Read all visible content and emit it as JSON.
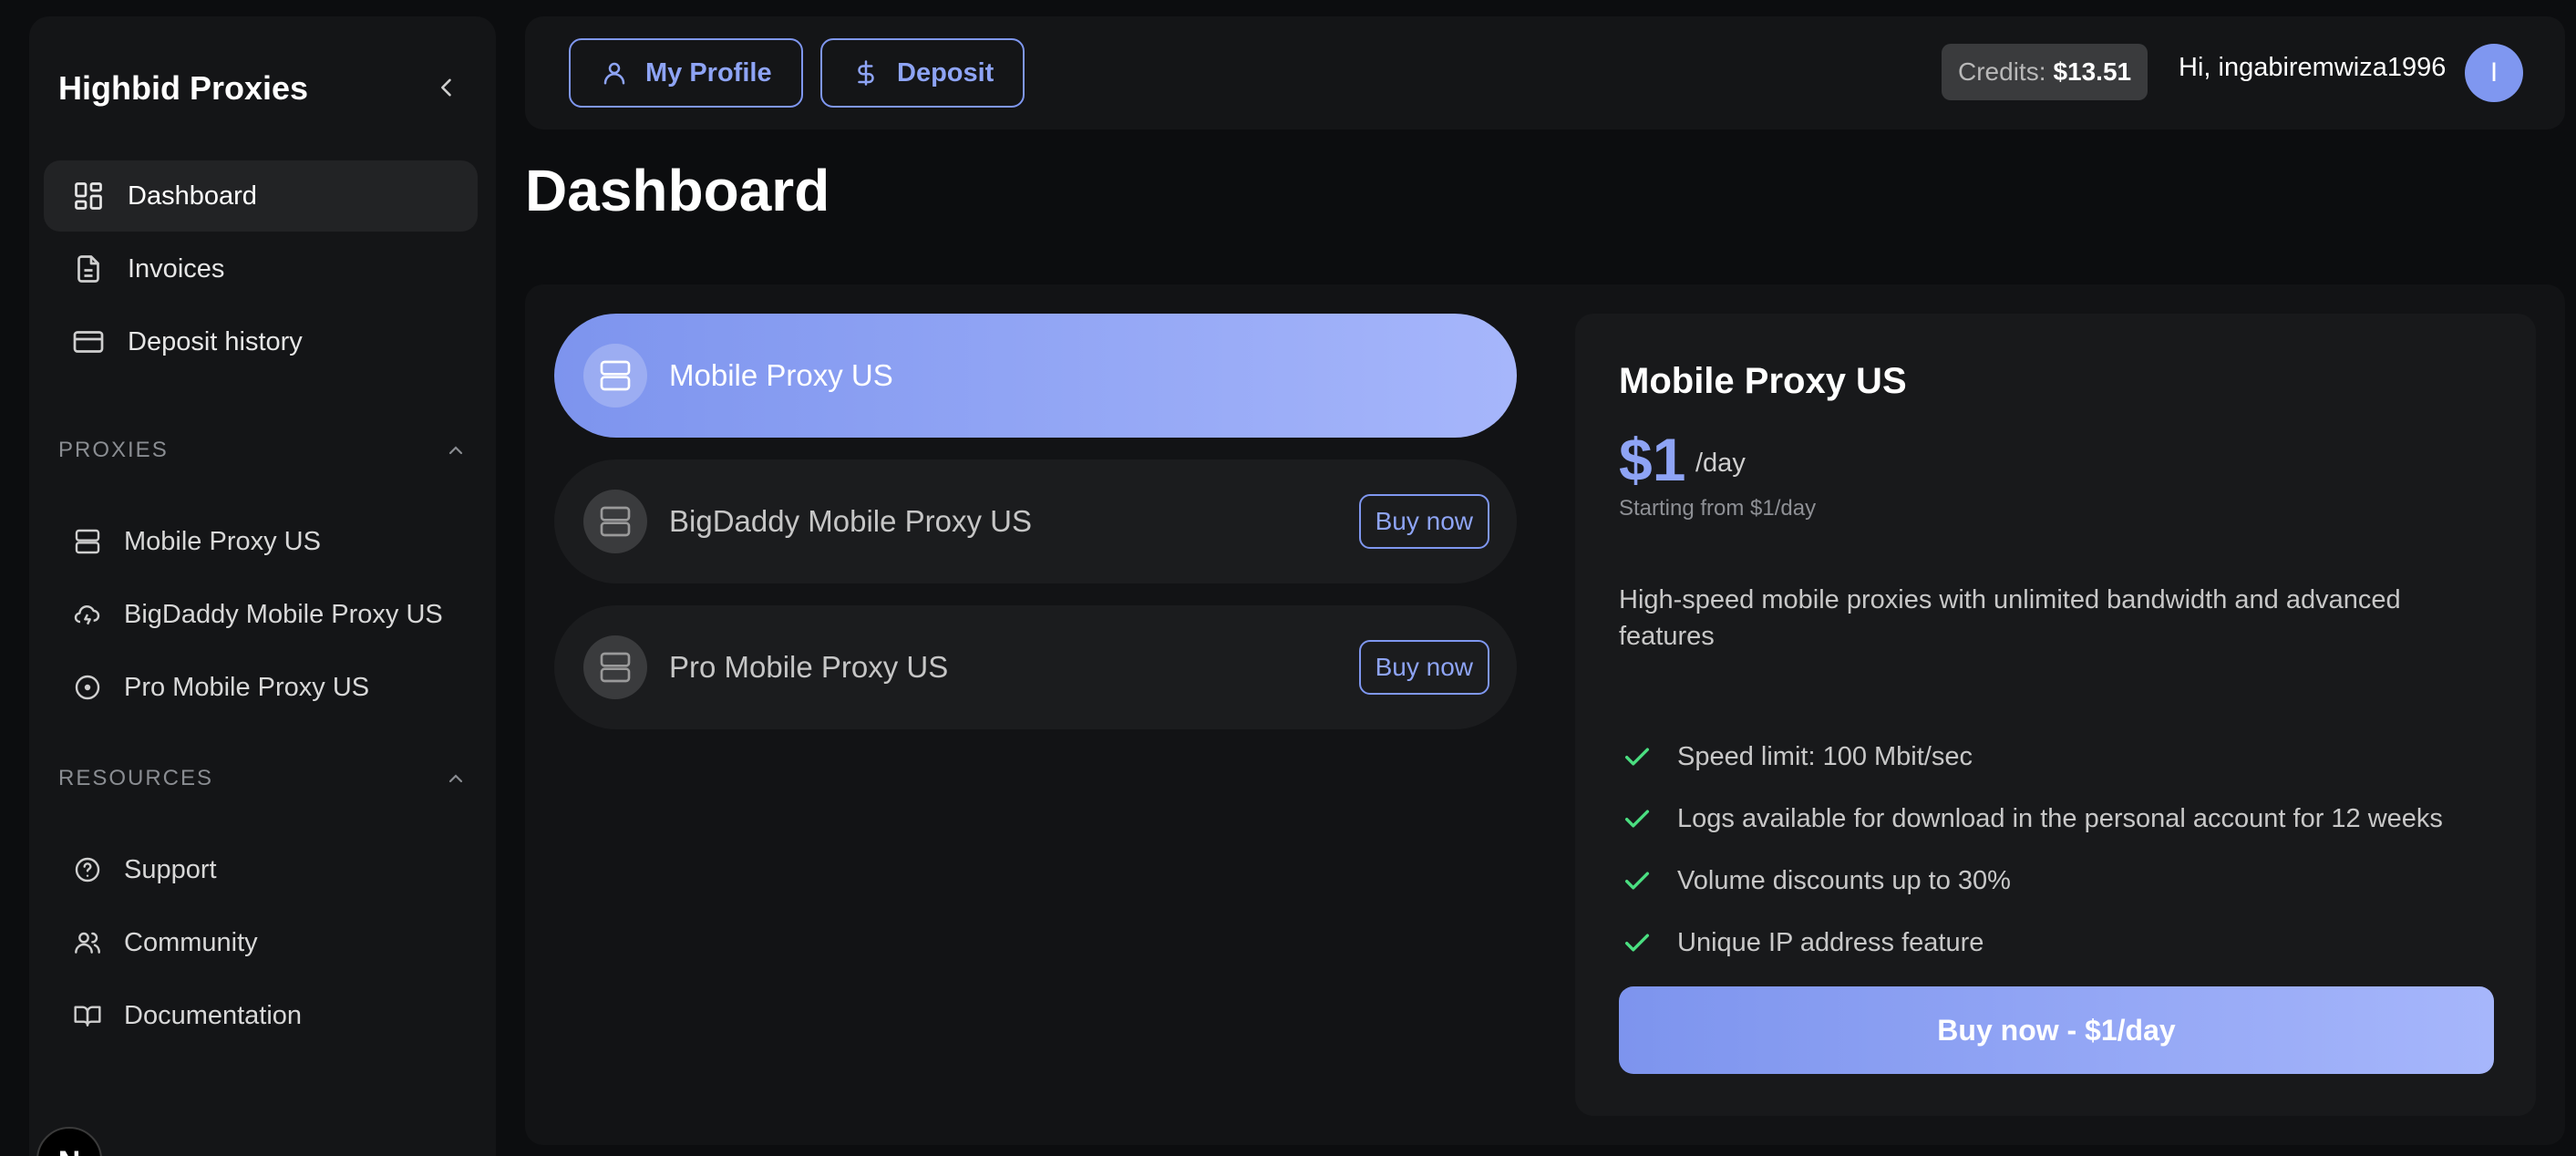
{
  "sidebar": {
    "brand": "Highbid Proxies",
    "nav": [
      {
        "label": "Dashboard",
        "icon": "dashboard-grid-icon",
        "active": true
      },
      {
        "label": "Invoices",
        "icon": "document-icon",
        "active": false
      },
      {
        "label": "Deposit history",
        "icon": "credit-card-icon",
        "active": false
      }
    ],
    "proxies": {
      "heading": "PROXIES",
      "items": [
        {
          "label": "Mobile Proxy US",
          "icon": "server-icon"
        },
        {
          "label": "BigDaddy Mobile Proxy US",
          "icon": "cloud-lightning-icon"
        },
        {
          "label": "Pro Mobile Proxy US",
          "icon": "target-icon"
        }
      ]
    },
    "resources": {
      "heading": "RESOURCES",
      "items": [
        {
          "label": "Support",
          "icon": "help-circle-icon"
        },
        {
          "label": "Community",
          "icon": "users-icon"
        },
        {
          "label": "Documentation",
          "icon": "book-icon"
        }
      ]
    },
    "badge": "N"
  },
  "topbar": {
    "profile_label": "My Profile",
    "deposit_label": "Deposit",
    "credits_label": "Credits:",
    "credits_value": "$13.51",
    "greeting": "Hi, ingabiremwiza1996",
    "avatar_initial": "I"
  },
  "page": {
    "title": "Dashboard"
  },
  "products": [
    {
      "name": "Mobile Proxy US",
      "selected": true
    },
    {
      "name": "BigDaddy Mobile Proxy US",
      "selected": false,
      "buy_label": "Buy now"
    },
    {
      "name": "Pro Mobile Proxy US",
      "selected": false,
      "buy_label": "Buy now"
    }
  ],
  "detail": {
    "title": "Mobile Proxy US",
    "price": "$1",
    "per": "/day",
    "starting": "Starting from $1/day",
    "description": "High-speed mobile proxies with unlimited bandwidth and advanced features",
    "features": [
      "Speed limit: 100 Mbit/sec",
      "Logs available for download in the personal account for 12 weeks",
      "Volume discounts up to 30%",
      "Unique IP address feature"
    ],
    "buy_label": "Buy now - $1/day"
  },
  "colors": {
    "accent": "#8ea4f5",
    "accent_start": "#7d94ee",
    "accent_end": "#a6b6fb",
    "check": "#4ade80",
    "background": "#0c0d0f",
    "panel": "#141517"
  }
}
